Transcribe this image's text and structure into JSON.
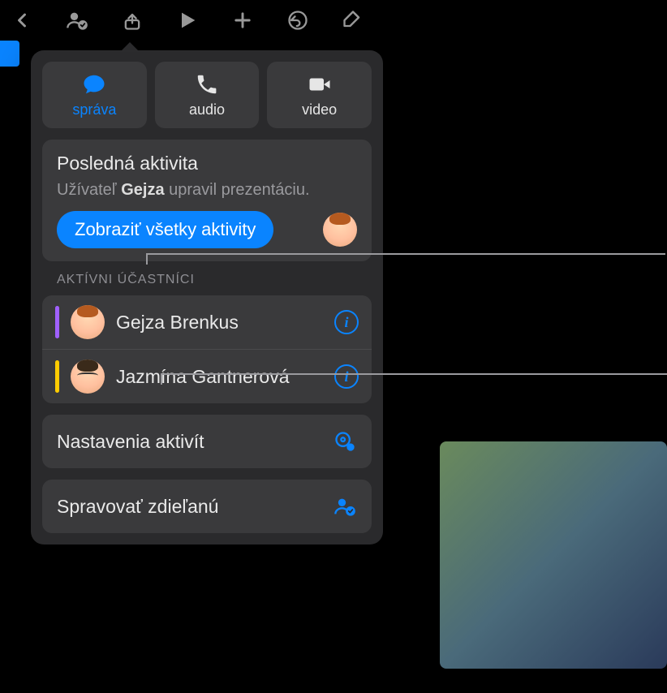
{
  "comms": {
    "message_label": "správa",
    "audio_label": "audio",
    "video_label": "video"
  },
  "recent_activity": {
    "title": "Posledná aktivita",
    "text_prefix": "Užívateľ ",
    "user": "Gejza",
    "text_suffix": " upravil prezentáciu.",
    "show_all_label": "Zobraziť všetky aktivity"
  },
  "participants_header": "AKTÍVNI ÚČASTNÍCI",
  "participants": [
    {
      "name": "Gejza Brenkus",
      "color": "#a060ff"
    },
    {
      "name": "Jazmína Gantnerová",
      "color": "#ffcc00"
    }
  ],
  "activity_settings_label": "Nastavenia aktivít",
  "manage_shared_label": "Spravovať zdieľanú"
}
